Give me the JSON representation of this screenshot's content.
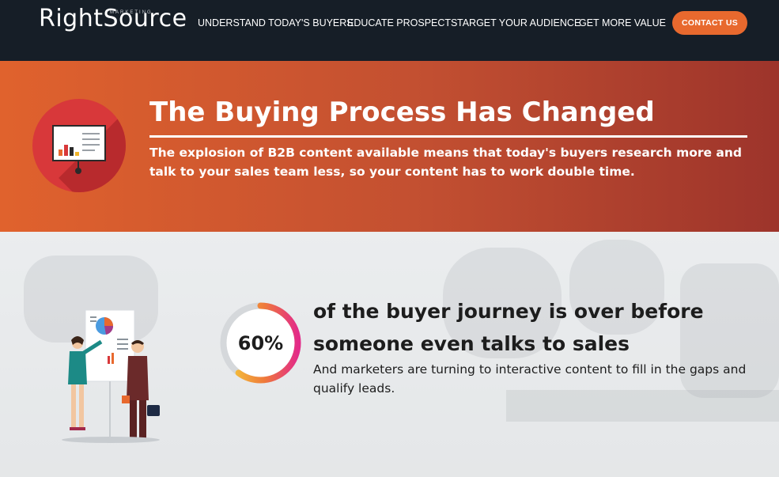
{
  "header": {
    "logo_text": "RightSource",
    "logo_tagline": "MARKETING",
    "nav_items": [
      "UNDERSTAND TODAY'S BUYERS",
      "EDUCATE PROSPECTS",
      "TARGET YOUR AUDIENCE",
      "GET MORE VALUE"
    ],
    "cta_label": "CONTACT US"
  },
  "hero": {
    "icon": "presentation-board-icon",
    "title": "The Buying Process Has Changed",
    "text": "The explosion of B2B content available means that today's buyers research more and talk to your sales team less, so your content has to work double time."
  },
  "stat": {
    "percent_label": "60%",
    "percent_value": 0.6,
    "headline": "of the buyer journey is over before someone even talks to sales",
    "body": "And marketers are turning to interactive content to fill in the gaps and qualify leads.",
    "illustration": "business-presentation-illustration"
  },
  "colors": {
    "nav_bg": "#161e27",
    "accent": "#e8692e",
    "hero_start": "#e0622d",
    "hero_end": "#9d342b"
  }
}
